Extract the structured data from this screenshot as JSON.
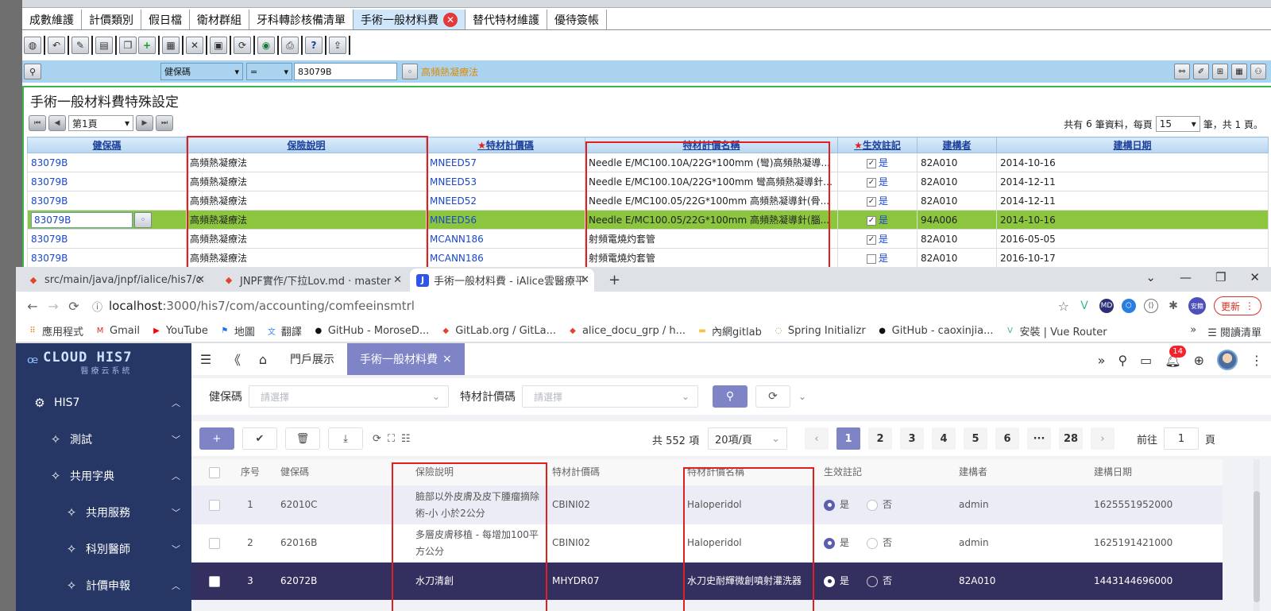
{
  "legacy": {
    "tabs": [
      "成數維護",
      "計價類別",
      "假日檔",
      "衛材群組",
      "牙科轉診核備清單",
      "手術一般材料費",
      "替代特材維護",
      "優待簽帳"
    ],
    "active_tab_index": 5,
    "query": {
      "field": "健保碼",
      "operator": "=",
      "value": "83079B",
      "value_name": "高頻熱凝療法"
    },
    "panel_title": "手術一般材料費特殊設定",
    "pager": {
      "page_label": "第1頁",
      "summary_prefix": "共有",
      "total": "6",
      "summary_mid": "筆資料，每頁",
      "page_size": "15",
      "summary_suffix": "筆，共 1 頁。"
    },
    "columns": [
      "健保碼",
      "保險說明",
      "特材計價碼",
      "特材計價名稱",
      "生效註記",
      "建構者",
      "建構日期"
    ],
    "required_columns": [
      2,
      4
    ],
    "rows": [
      {
        "code": "83079B",
        "desc": "高頻熱凝療法",
        "mat_code": "MNEED57",
        "mat_name": "Needle E/MC100.10A/22G*100mm (彎)高頻熱凝導...",
        "checked": true,
        "active": "是",
        "builder": "82A010",
        "date": "2014-10-16"
      },
      {
        "code": "83079B",
        "desc": "高頻熱凝療法",
        "mat_code": "MNEED53",
        "mat_name": "Needle E/MC100.10A/22G*100mm 彎高頻熱凝導針(...",
        "checked": true,
        "active": "是",
        "builder": "82A010",
        "date": "2014-12-11"
      },
      {
        "code": "83079B",
        "desc": "高頻熱凝療法",
        "mat_code": "MNEED52",
        "mat_name": "Needle E/MC100.05/22G*100mm 高頻熱凝導針(骨...",
        "checked": true,
        "active": "是",
        "builder": "82A010",
        "date": "2014-12-11"
      },
      {
        "code": "83079B",
        "desc": "高頻熱凝療法",
        "mat_code": "MNEED56",
        "mat_name": "Needle E/MC100.05/22G*100mm 高頻熱凝導針(腦...",
        "checked": true,
        "active": "是",
        "builder": "94A006",
        "date": "2014-10-16",
        "selected": true
      },
      {
        "code": "83079B",
        "desc": "高頻熱凝療法",
        "mat_code": "MCANN186",
        "mat_name": "射頻電燒灼套管",
        "checked": true,
        "active": "是",
        "builder": "82A010",
        "date": "2016-05-05"
      },
      {
        "code": "83079B",
        "desc": "高頻熱凝療法",
        "mat_code": "MCANN186",
        "mat_name": "射頻電燒灼套管",
        "checked": false,
        "active": "是",
        "builder": "82A010",
        "date": "2016-10-17"
      }
    ]
  },
  "browser": {
    "tabs": [
      {
        "title": "src/main/java/jnpf/ialice/his7/c",
        "icon": "gitlab-icon"
      },
      {
        "title": "JNPF實作/下拉Lov.md · master",
        "icon": "gitlab-icon"
      },
      {
        "title": "手術一般材料費 - iAlice雲醫療平",
        "icon": "j-icon",
        "active": true
      }
    ],
    "url_host": "localhost",
    "url_path": ":3000/his7/com/accounting/comfeeinsmtrl",
    "update_label": "更新",
    "profile_label": "安籍",
    "bookmarks": [
      "應用程式",
      "Gmail",
      "YouTube",
      "地圖",
      "翻譯",
      "GitHub - MoroseD...",
      "GitLab.org / GitLa...",
      "alice_docu_grp / h...",
      "內網gitlab",
      "Spring Initializr",
      "GitHub - caoxinjia...",
      "安裝 | Vue Router"
    ],
    "reading_list": "閱讀清單"
  },
  "app": {
    "logo": {
      "text": "CLOUD HIS7",
      "subtitle": "醫療云系統"
    },
    "sidebar": [
      {
        "label": "HIS7",
        "level": 0,
        "expanded": true
      },
      {
        "label": "測試",
        "level": 1,
        "expanded": false
      },
      {
        "label": "共用字典",
        "level": 1,
        "expanded": true
      },
      {
        "label": "共用服務",
        "level": 2,
        "expanded": false
      },
      {
        "label": "科別醫師",
        "level": 2,
        "expanded": false
      },
      {
        "label": "計價申報",
        "level": 2,
        "expanded": true
      }
    ],
    "tabs": [
      "門戶展示",
      "手術一般材料費"
    ],
    "active_tab_index": 1,
    "notification_count": "14",
    "filters": [
      {
        "label": "健保碼",
        "placeholder": "請選擇"
      },
      {
        "label": "特材計價碼",
        "placeholder": "請選擇"
      }
    ],
    "total_label": "共 552 項",
    "page_size": "20項/頁",
    "pages": [
      "1",
      "2",
      "3",
      "4",
      "5",
      "6",
      "···",
      "28"
    ],
    "active_page": "1",
    "goto_prefix": "前往",
    "goto_value": "1",
    "goto_suffix": "頁",
    "columns": [
      "序号",
      "健保碼",
      "保險說明",
      "特材計價碼",
      "特材計價名稱",
      "生效註記",
      "建構者",
      "建構日期"
    ],
    "radio_yes": "是",
    "radio_no": "否",
    "rows": [
      {
        "no": "1",
        "code": "62010C",
        "desc": "臉部以外皮膚及皮下腫瘤摘除術-小 小於2公分",
        "mat_code": "CBINI02",
        "mat_name": "Haloperidol",
        "active": "yes",
        "builder": "admin",
        "timestamp": "1625551952000"
      },
      {
        "no": "2",
        "code": "62016B",
        "desc": "多層皮膚移植 - 每增加100平方公分",
        "mat_code": "CBINI02",
        "mat_name": "Haloperidol",
        "active": "yes",
        "builder": "admin",
        "timestamp": "1625191421000"
      },
      {
        "no": "3",
        "code": "62072B",
        "desc": "水刀清創",
        "mat_code": "MHYDR07",
        "mat_name": "水刀史耐輝微創噴射灌洗器",
        "active": "yes",
        "builder": "82A010",
        "timestamp": "1443144696000",
        "selected": true
      }
    ]
  }
}
